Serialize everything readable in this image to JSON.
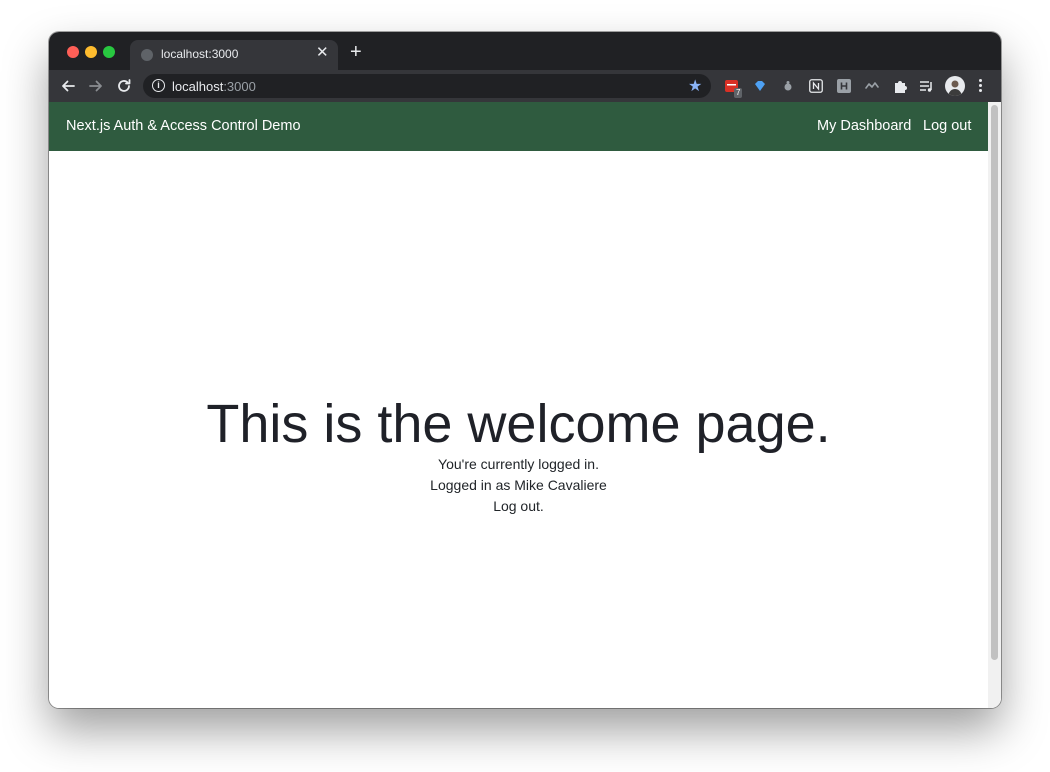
{
  "browser": {
    "tab_title": "localhost:3000",
    "url_host": "localhost",
    "url_port": ":3000",
    "extension_badge": "7",
    "colors": {
      "close": "#ff5f57",
      "minimize": "#febc2e",
      "zoom": "#28c840",
      "star": "#8ab4f8"
    }
  },
  "app": {
    "brand": "Next.js Auth & Access Control Demo",
    "nav": {
      "dashboard": "My Dashboard",
      "logout": "Log out"
    },
    "nav_color": "#2f5b3f",
    "heading": "This is the welcome page.",
    "status": "You're currently logged in.",
    "logged_in_as": "Logged in as Mike Cavaliere",
    "logout_link": "Log out."
  }
}
